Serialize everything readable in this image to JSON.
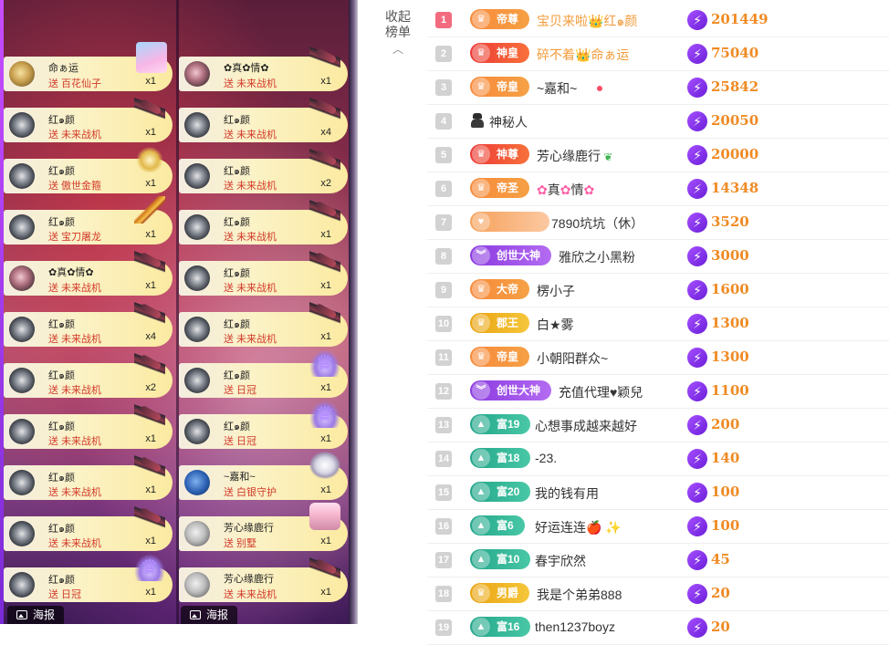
{
  "gift_feed": {
    "column_1": [
      {
        "name": "命ぁ运",
        "gift": "送 百花仙子",
        "count": "x1",
        "icon": "fairy-gift-icon",
        "avatar": "a1"
      },
      {
        "name": "红๑颜",
        "gift": "送 未来战机",
        "count": "x1",
        "icon": "fighter-gift-icon",
        "avatar": ""
      },
      {
        "name": "红๑颜",
        "gift": "送 傲世金箍",
        "count": "x1",
        "icon": "golden-hoop-gift-icon",
        "avatar": ""
      },
      {
        "name": "红๑颜",
        "gift": "送 宝刀屠龙",
        "count": "x1",
        "icon": "dragon-blade-gift-icon",
        "avatar": ""
      },
      {
        "name": "✿真✿情✿",
        "gift": "送 未来战机",
        "count": "x1",
        "icon": "fighter-gift-icon",
        "avatar": "a2"
      },
      {
        "name": "红๑颜",
        "gift": "送 未来战机",
        "count": "x4",
        "icon": "fighter-gift-icon",
        "avatar": ""
      },
      {
        "name": "红๑颜",
        "gift": "送 未来战机",
        "count": "x2",
        "icon": "fighter-gift-icon",
        "avatar": ""
      },
      {
        "name": "红๑颜",
        "gift": "送 未来战机",
        "count": "x1",
        "icon": "fighter-gift-icon",
        "avatar": ""
      },
      {
        "name": "红๑颜",
        "gift": "送 未来战机",
        "count": "x1",
        "icon": "fighter-gift-icon",
        "avatar": ""
      },
      {
        "name": "红๑颜",
        "gift": "送 未来战机",
        "count": "x1",
        "icon": "fighter-gift-icon",
        "avatar": ""
      },
      {
        "name": "红๑颜",
        "gift": "送 日冠",
        "count": "x1",
        "icon": "crown-gift-icon",
        "avatar": ""
      }
    ],
    "column_2": [
      {
        "name": "✿真✿情✿",
        "gift": "送 未来战机",
        "count": "x1",
        "icon": "fighter-gift-icon",
        "avatar": "a2"
      },
      {
        "name": "红๑颜",
        "gift": "送 未来战机",
        "count": "x4",
        "icon": "fighter-gift-icon",
        "avatar": ""
      },
      {
        "name": "红๑颜",
        "gift": "送 未来战机",
        "count": "x2",
        "icon": "fighter-gift-icon",
        "avatar": ""
      },
      {
        "name": "红๑颜",
        "gift": "送 未来战机",
        "count": "x1",
        "icon": "fighter-gift-icon",
        "avatar": ""
      },
      {
        "name": "红๑颜",
        "gift": "送 未来战机",
        "count": "x1",
        "icon": "fighter-gift-icon",
        "avatar": ""
      },
      {
        "name": "红๑颜",
        "gift": "送 未来战机",
        "count": "x1",
        "icon": "fighter-gift-icon",
        "avatar": ""
      },
      {
        "name": "红๑颜",
        "gift": "送 日冠",
        "count": "x1",
        "icon": "crown-gift-icon",
        "avatar": ""
      },
      {
        "name": "红๑颜",
        "gift": "送 日冠",
        "count": "x1",
        "icon": "crown-gift-icon",
        "avatar": ""
      },
      {
        "name": "~嘉和~",
        "gift": "送 白银守护",
        "count": "x1",
        "icon": "silver-guard-gift-icon",
        "avatar": "a3"
      },
      {
        "name": "芳心缘鹿行",
        "gift": "送 别墅",
        "count": "x1",
        "icon": "villa-gift-icon",
        "avatar": "a4"
      },
      {
        "name": "芳心缘鹿行",
        "gift": "送 未来战机",
        "count": "x1",
        "icon": "fighter-gift-icon",
        "avatar": "a4"
      }
    ],
    "poster_label": "海报"
  },
  "panel": {
    "collapse_line1": "收起",
    "collapse_line2": "榜单"
  },
  "ranking": [
    {
      "rank": "1",
      "badge": "帝尊",
      "badge_style": "b-orange",
      "badge_icon": "crown-badge-icon",
      "name": "宝贝来啦👑红๑颜",
      "highlight": true,
      "score": "201449"
    },
    {
      "rank": "2",
      "badge": "神皇",
      "badge_style": "b-red",
      "badge_icon": "flame-badge-icon",
      "name": "碎不着👑命ぁ运",
      "highlight": true,
      "score": "75040"
    },
    {
      "rank": "3",
      "badge": "帝皇",
      "badge_style": "b-orange",
      "badge_icon": "crown-badge-icon",
      "name": "~嘉和~",
      "highlight": false,
      "score": "25842",
      "dot": true
    },
    {
      "rank": "4",
      "badge": "",
      "badge_style": "mystery",
      "badge_icon": "mystery-person-icon",
      "name": "神秘人",
      "highlight": false,
      "score": "20050"
    },
    {
      "rank": "5",
      "badge": "神尊",
      "badge_style": "b-red",
      "badge_icon": "flame-badge-icon",
      "name": "芳心缘鹿行",
      "highlight": false,
      "score": "20000",
      "leaf": true
    },
    {
      "rank": "6",
      "badge": "帝圣",
      "badge_style": "b-orange",
      "badge_icon": "crown-badge-icon",
      "name": "✿真✿情✿",
      "highlight": false,
      "score": "14348",
      "blossom": true
    },
    {
      "rank": "7",
      "badge": "",
      "badge_style": "b-plain",
      "badge_icon": "heart-badge-icon",
      "name": "7890坑坑（休）",
      "highlight": false,
      "score": "3520"
    },
    {
      "rank": "8",
      "badge": "创世大神",
      "badge_style": "b-purple",
      "badge_icon": "chevron-badge-icon",
      "name": "雅欣之小黑粉",
      "highlight": false,
      "score": "3000"
    },
    {
      "rank": "9",
      "badge": "大帝",
      "badge_style": "b-orange",
      "badge_icon": "crown-badge-icon",
      "name": "楞小子",
      "highlight": false,
      "score": "1600"
    },
    {
      "rank": "10",
      "badge": "郡王",
      "badge_style": "b-gold",
      "badge_icon": "crown-badge-icon",
      "name": "白★雾",
      "highlight": false,
      "score": "1300"
    },
    {
      "rank": "11",
      "badge": "帝皇",
      "badge_style": "b-orange",
      "badge_icon": "crown-badge-icon",
      "name": "小朝阳群众~",
      "highlight": false,
      "score": "1300"
    },
    {
      "rank": "12",
      "badge": "创世大神",
      "badge_style": "b-purple",
      "badge_icon": "chevron-badge-icon",
      "name": "充值代理♥颖兒",
      "highlight": false,
      "score": "1100"
    },
    {
      "rank": "13",
      "badge": "富19",
      "badge_style": "b-teal",
      "badge_icon": "triangle-badge-icon",
      "name": "心想事成越来越好",
      "highlight": false,
      "score": "200"
    },
    {
      "rank": "14",
      "badge": "富18",
      "badge_style": "b-teal",
      "badge_icon": "triangle-badge-icon",
      "name": "-23.",
      "highlight": false,
      "score": "140"
    },
    {
      "rank": "15",
      "badge": "富20",
      "badge_style": "b-teal",
      "badge_icon": "triangle-badge-icon",
      "name": "我的钱有用",
      "highlight": false,
      "score": "100"
    },
    {
      "rank": "16",
      "badge": "富6",
      "badge_style": "b-teal",
      "badge_icon": "triangle-badge-icon",
      "name": "好运连连🍎 ✨",
      "highlight": false,
      "score": "100"
    },
    {
      "rank": "17",
      "badge": "富10",
      "badge_style": "b-teal",
      "badge_icon": "triangle-badge-icon",
      "name": "春宇欣然",
      "highlight": false,
      "score": "45"
    },
    {
      "rank": "18",
      "badge": "男爵",
      "badge_style": "b-gold",
      "badge_icon": "crown-badge-icon",
      "name": "我是个弟弟888",
      "highlight": false,
      "score": "20"
    },
    {
      "rank": "19",
      "badge": "富16",
      "badge_style": "b-teal",
      "badge_icon": "triangle-badge-icon",
      "name": "then1237boyz",
      "highlight": false,
      "score": "20"
    }
  ],
  "colors": {
    "score": "#f08a23",
    "rank_first": "#f36b7f",
    "highlight_name": "#f39b3a",
    "gift_text": "#d23a2a"
  }
}
